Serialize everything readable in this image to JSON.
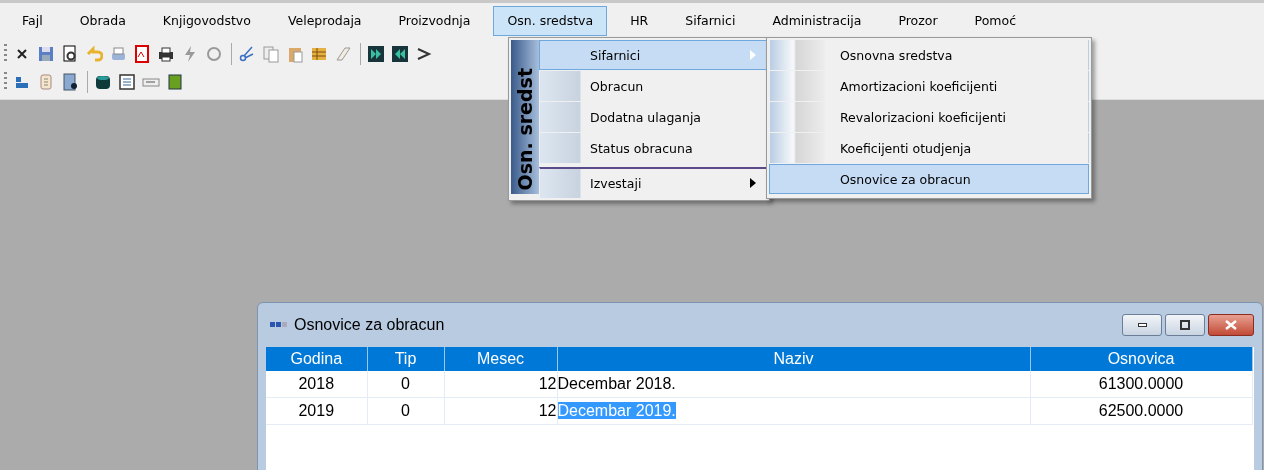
{
  "menubar": [
    {
      "label": "Fajl",
      "selected": false
    },
    {
      "label": "Obrada",
      "selected": false
    },
    {
      "label": "Knjigovodstvo",
      "selected": false
    },
    {
      "label": "Veleprodaja",
      "selected": false
    },
    {
      "label": "Proizvodnja",
      "selected": false
    },
    {
      "label": "Osn. sredstva",
      "selected": true
    },
    {
      "label": "HR",
      "selected": false
    },
    {
      "label": "Sifarnici",
      "selected": false
    },
    {
      "label": "Administracija",
      "selected": false
    },
    {
      "label": "Prozor",
      "selected": false
    },
    {
      "label": "Pomoć",
      "selected": false
    }
  ],
  "dropdown": {
    "side_label": "Osn. sredst",
    "items": [
      {
        "label": "Sifarnici",
        "selected": true,
        "submenu": true,
        "separator_before": false
      },
      {
        "label": "Obracun",
        "selected": false,
        "submenu": false,
        "separator_before": false
      },
      {
        "label": "Dodatna ulaganja",
        "selected": false,
        "submenu": false,
        "separator_before": false
      },
      {
        "label": "Status obracuna",
        "selected": false,
        "submenu": false,
        "separator_before": false
      },
      {
        "label": "Izvestaji",
        "selected": false,
        "submenu": true,
        "separator_before": true
      }
    ]
  },
  "submenu": {
    "items": [
      {
        "label": "Osnovna sredstva",
        "selected": false
      },
      {
        "label": "Amortizacioni koeficijenti",
        "selected": false
      },
      {
        "label": "Revalorizacioni koeficijenti",
        "selected": false
      },
      {
        "label": "Koeficijenti otudjenja",
        "selected": false
      },
      {
        "label": "Osnovice za obracun",
        "selected": true
      }
    ]
  },
  "child_window": {
    "title": "Osnovice za obracun",
    "table": {
      "columns": [
        "Godina",
        "Tip",
        "Mesec",
        "Naziv",
        "Osnovica"
      ],
      "rows": [
        {
          "cells": [
            "2018",
            "0",
            "12",
            "Decembar 2018.",
            "61300.0000"
          ],
          "selected": false
        },
        {
          "cells": [
            "2019",
            "0",
            "12",
            "Decembar 2019.",
            "62500.0000"
          ],
          "selected": true
        }
      ]
    }
  }
}
